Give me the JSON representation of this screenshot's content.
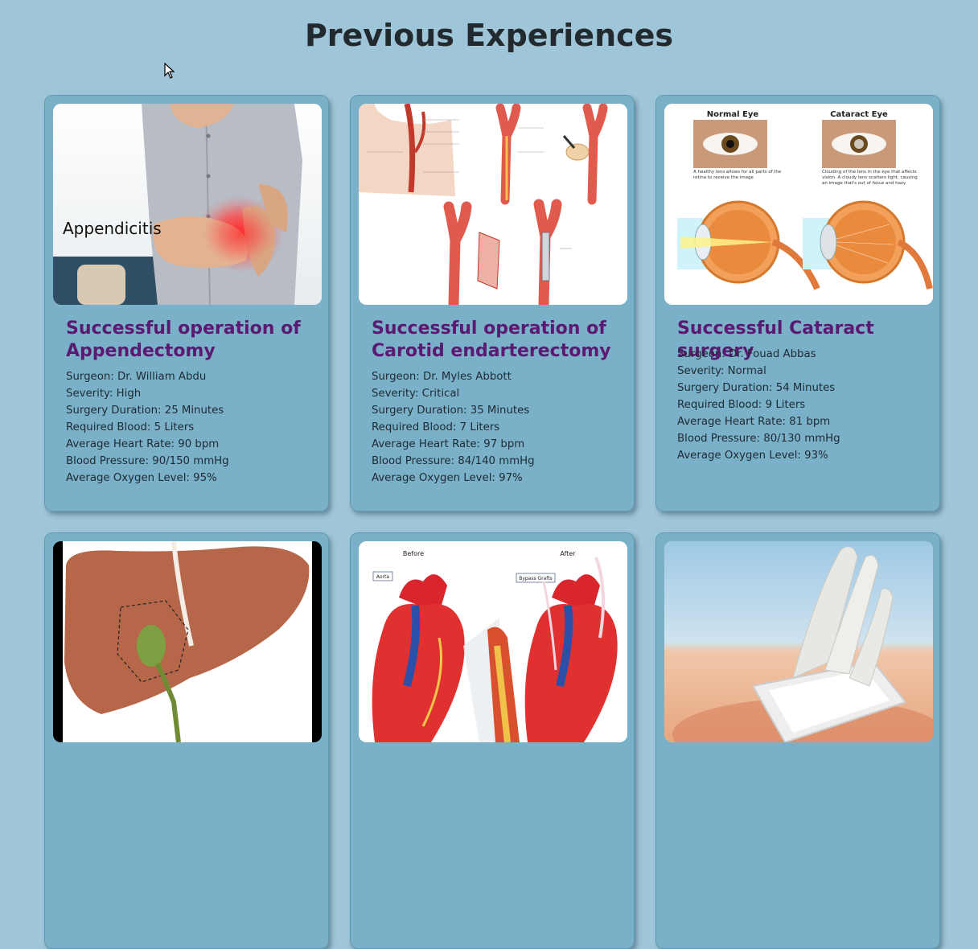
{
  "page": {
    "title": "Previous Experiences"
  },
  "cards": [
    {
      "title": "Successful operation of Appendectomy",
      "image_icon": "appendicitis-photo",
      "image_caption": "Appendicitis",
      "details": [
        "Surgeon: Dr. William Abdu",
        "Severity: High",
        "Surgery Duration: 25 Minutes",
        "Required Blood: 5 Liters",
        "Average Heart Rate: 90 bpm",
        "Blood Pressure: 90/150 mmHg",
        "Average Oxygen Level: 95%"
      ]
    },
    {
      "title": "Successful operation of Carotid endarterectomy",
      "image_icon": "carotid-artery-diagram",
      "details": [
        "Surgeon: Dr. Myles Abbott",
        "Severity: Critical",
        "Surgery Duration: 35 Minutes",
        "Required Blood: 7 Liters",
        "Average Heart Rate: 97 bpm",
        "Blood Pressure: 84/140 mmHg",
        "Average Oxygen Level: 97%"
      ]
    },
    {
      "title": "Successful Cataract surgery",
      "image_icon": "cataract-eye-diagram",
      "image_labels": {
        "left_heading": "Normal Eye",
        "right_heading": "Cataract Eye",
        "left_caption": "A healthy lens allows for all parts of the retina to receive the image",
        "right_caption": "Clouding of the lens in the eye that affects vision. A cloudy lens scatters light, causing an image that's out of focus and hazy"
      },
      "details": [
        "Surgeon: Dr. Fouad Abbas",
        "Severity: Normal",
        "Surgery Duration: 54 Minutes",
        "Required Blood: 9 Liters",
        "Average Heart Rate: 81 bpm",
        "Blood Pressure: 80/130 mmHg",
        "Average Oxygen Level: 93%"
      ]
    },
    {
      "image_icon": "liver-gallbladder-diagram"
    },
    {
      "image_icon": "heart-bypass-diagram",
      "image_labels": {
        "before": "Before",
        "after": "After",
        "aorta": "Aorta",
        "grafts": "Bypass Grafts"
      }
    },
    {
      "image_icon": "surgical-gauze-illustration"
    }
  ],
  "colors": {
    "background": "#9fc5d8",
    "card": "#7ab0c8",
    "title": "#5b1a72",
    "text": "#1e2a33"
  }
}
